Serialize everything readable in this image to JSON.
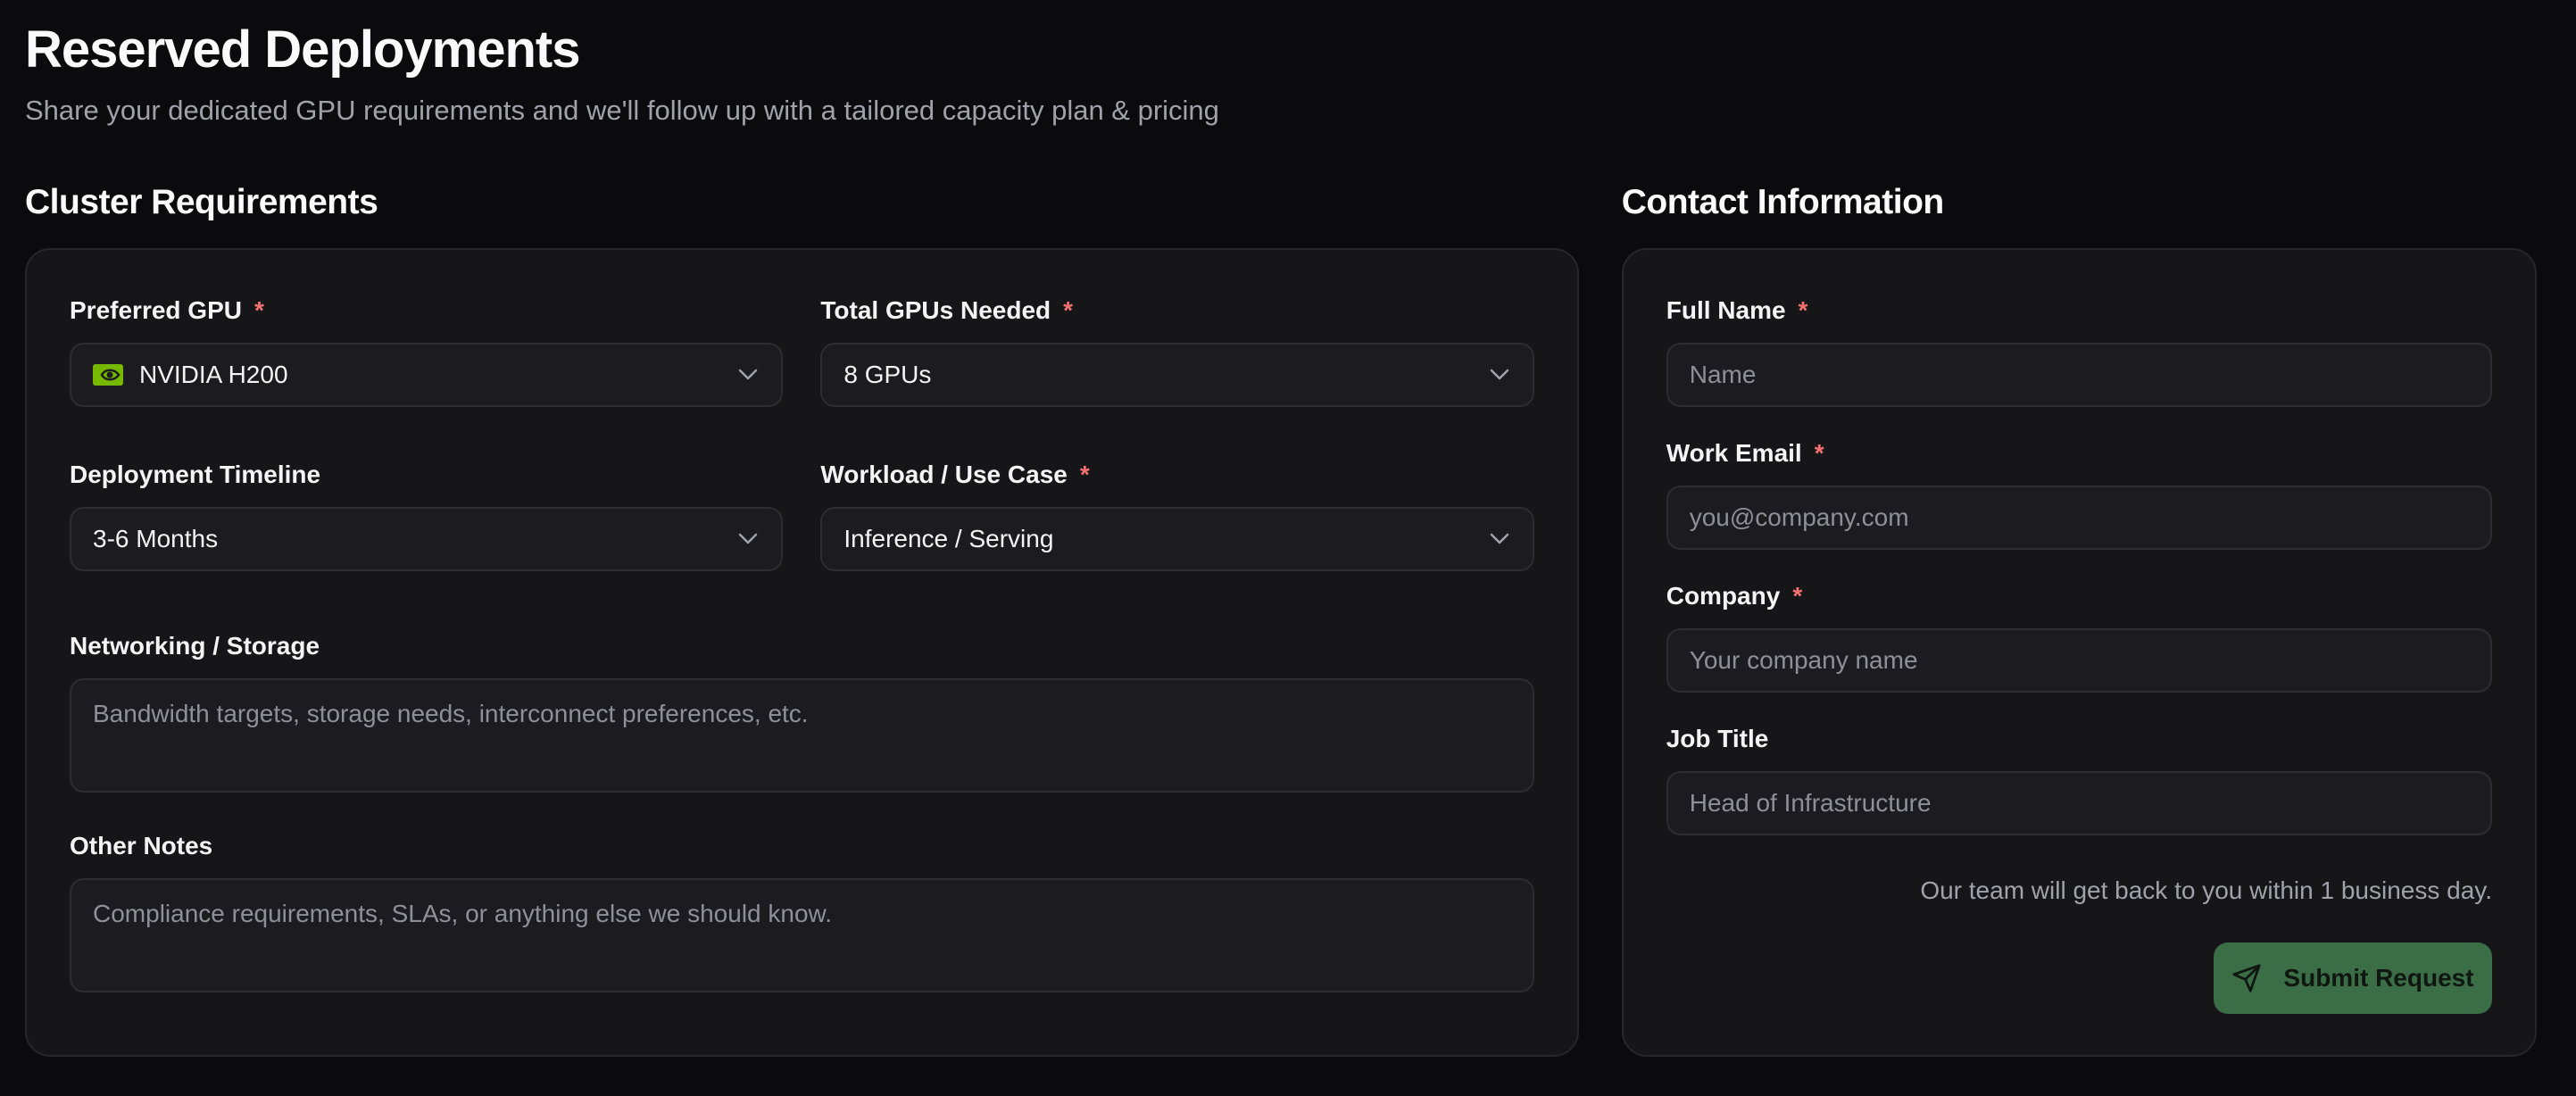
{
  "header": {
    "title": "Reserved Deployments",
    "subtitle": "Share your dedicated GPU requirements and we'll follow up with a tailored capacity plan & pricing"
  },
  "cluster": {
    "section_title": "Cluster Requirements",
    "preferred_gpu": {
      "label": "Preferred GPU",
      "required_mark": "*",
      "value": "NVIDIA H200",
      "icon": "nvidia-logo-icon"
    },
    "total_gpus": {
      "label": "Total GPUs Needed",
      "required_mark": "*",
      "value": "8 GPUs"
    },
    "timeline": {
      "label": "Deployment Timeline",
      "value": "3-6 Months"
    },
    "workload": {
      "label": "Workload / Use Case",
      "required_mark": "*",
      "value": "Inference / Serving"
    },
    "networking": {
      "label": "Networking / Storage",
      "placeholder": "Bandwidth targets, storage needs, interconnect preferences, etc."
    },
    "notes": {
      "label": "Other Notes",
      "placeholder": "Compliance requirements, SLAs, or anything else we should know."
    }
  },
  "contact": {
    "section_title": "Contact Information",
    "full_name": {
      "label": "Full Name",
      "required_mark": "*",
      "placeholder": "Name"
    },
    "work_email": {
      "label": "Work Email",
      "required_mark": "*",
      "placeholder": "you@company.com"
    },
    "company": {
      "label": "Company",
      "required_mark": "*",
      "placeholder": "Your company name"
    },
    "job_title": {
      "label": "Job Title",
      "placeholder": "Head of Infrastructure"
    },
    "note": "Our team will get back to you within 1 business day.",
    "submit_label": "Submit Request",
    "submit_icon": "send-icon"
  },
  "colors": {
    "background": "#0b0b0d",
    "card": "#161619",
    "required": "#f87171",
    "accent_button": "#3b6e47",
    "nvidia_green": "#76b900"
  }
}
